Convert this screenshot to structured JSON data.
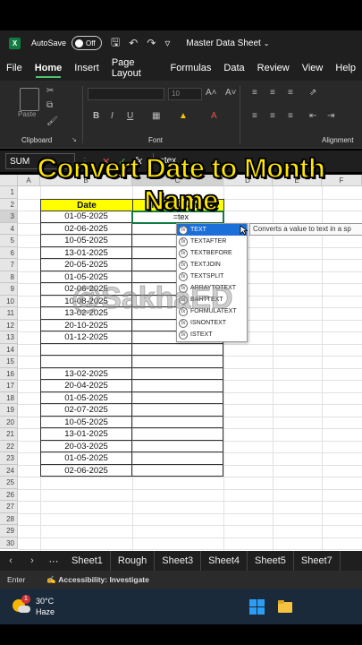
{
  "titlebar": {
    "autosave_label": "AutoSave",
    "toggle_state": "Off",
    "doc_title": "Master Data Sheet"
  },
  "menu": [
    "File",
    "Home",
    "Insert",
    "Page Layout",
    "Formulas",
    "Data",
    "Review",
    "View",
    "Help"
  ],
  "ribbon": {
    "clipboard_label": "Clipboard",
    "font_label": "Font",
    "alignment_label": "Alignment",
    "paste_label": "Paste",
    "font_size": "10"
  },
  "formula_bar": {
    "name_box": "SUM",
    "fx": "fx",
    "formula": "=tex"
  },
  "columns": [
    "A",
    "B",
    "C",
    "D",
    "E",
    "F"
  ],
  "rows": [
    "1",
    "2",
    "3",
    "4",
    "5",
    "6",
    "7",
    "8",
    "9",
    "10",
    "11",
    "12",
    "13",
    "14",
    "15",
    "16",
    "17",
    "18",
    "19",
    "20",
    "21",
    "22",
    "23",
    "24",
    "25",
    "26",
    "27",
    "28",
    "29",
    "30"
  ],
  "table": {
    "header_date": "Date",
    "header_month": "Month Name",
    "dates": [
      "01-05-2025",
      "02-06-2025",
      "10-05-2025",
      "13-01-2025",
      "20-05-2025",
      "01-05-2025",
      "02-06-2025",
      "10-08-2025",
      "13-02-2025",
      "20-10-2025",
      "01-12-2025",
      "",
      "",
      "13-02-2025",
      "20-04-2025",
      "01-05-2025",
      "02-07-2025",
      "10-05-2025",
      "13-01-2025",
      "20-03-2025",
      "01-05-2025",
      "02-06-2025"
    ]
  },
  "active_cell_value": "=tex",
  "autocomplete": {
    "items": [
      "TEXT",
      "TEXTAFTER",
      "TEXTBEFORE",
      "TEXTJOIN",
      "TEXTSPLIT",
      "ARRAYTOTEXT",
      "BAHTTEXT",
      "FORMULATEXT",
      "ISNONTEXT",
      "ISTEXT"
    ],
    "tooltip": "Converts a value to text in a sp"
  },
  "overlay": {
    "title": "Convert Date to Month Name",
    "watermark": "@SakhaED"
  },
  "sheets": [
    "Sheet1",
    "Rough",
    "Sheet3",
    "Sheet4",
    "Sheet5",
    "Sheet7"
  ],
  "status": {
    "mode": "Enter",
    "accessibility": "Accessibility: Investigate"
  },
  "taskbar": {
    "temp": "30°C",
    "condition": "Haze",
    "badge": "1"
  }
}
